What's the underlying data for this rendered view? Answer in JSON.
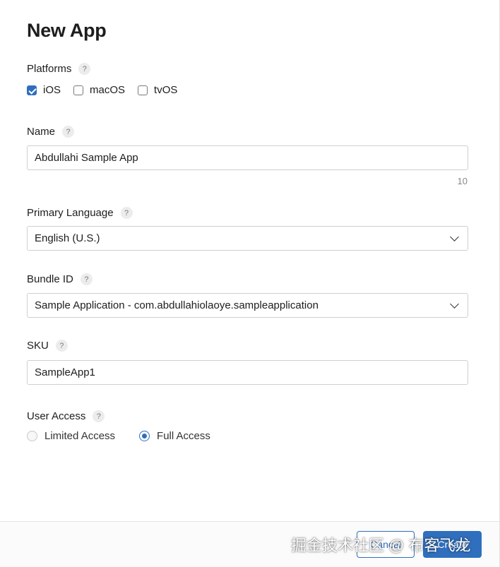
{
  "dialog": {
    "title": "New App"
  },
  "platforms": {
    "label": "Platforms",
    "help": "?",
    "options": [
      {
        "label": "iOS",
        "checked": true
      },
      {
        "label": "macOS",
        "checked": false
      },
      {
        "label": "tvOS",
        "checked": false
      }
    ]
  },
  "name": {
    "label": "Name",
    "help": "?",
    "value": "Abdullahi Sample App",
    "counter": "10"
  },
  "primary_language": {
    "label": "Primary Language",
    "help": "?",
    "selected": "English (U.S.)"
  },
  "bundle_id": {
    "label": "Bundle ID",
    "help": "?",
    "selected": "Sample Application - com.abdullahiolaoye.sampleapplication"
  },
  "sku": {
    "label": "SKU",
    "help": "?",
    "value": "SampleApp1"
  },
  "user_access": {
    "label": "User Access",
    "help": "?",
    "options": [
      {
        "label": "Limited Access",
        "selected": false
      },
      {
        "label": "Full Access",
        "selected": true
      }
    ]
  },
  "footer": {
    "cancel_label": "Cancel",
    "create_label": "Create"
  },
  "watermark": "掘金技术社区 @ 布客飞龙",
  "colors": {
    "accent": "#2f6fbd",
    "border": "#cfcfcf",
    "text": "#1d1d1f"
  }
}
